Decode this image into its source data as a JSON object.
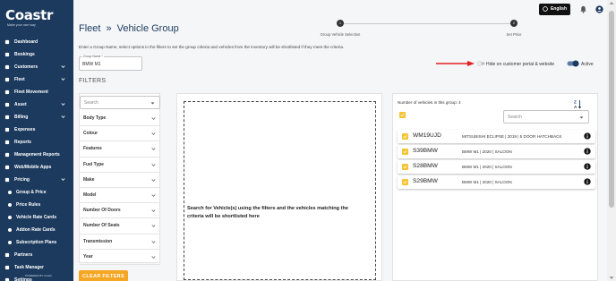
{
  "brand": {
    "logo_text": "Coastr",
    "tagline": "Make your own way"
  },
  "sidebar": {
    "items": [
      {
        "label": "Dashboard",
        "icon": "dashboard-icon",
        "expandable": false
      },
      {
        "label": "Bookings",
        "icon": "bookings-icon",
        "expandable": false
      },
      {
        "label": "Customers",
        "icon": "customers-icon",
        "expandable": true
      },
      {
        "label": "Fleet",
        "icon": "fleet-icon",
        "expandable": true
      },
      {
        "label": "Fleet Movement",
        "icon": "fleet-movement-icon",
        "expandable": false
      },
      {
        "label": "Asset",
        "icon": "asset-icon",
        "expandable": true
      },
      {
        "label": "Billing",
        "icon": "billing-icon",
        "expandable": true
      },
      {
        "label": "Expenses",
        "icon": "expenses-icon",
        "expandable": false
      },
      {
        "label": "Reports",
        "icon": "reports-icon",
        "expandable": false
      },
      {
        "label": "Management Reports",
        "icon": "management-reports-icon",
        "expandable": false
      },
      {
        "label": "Web/Mobile Apps",
        "icon": "web-mobile-apps-icon",
        "expandable": false
      },
      {
        "label": "Pricing",
        "icon": "pricing-icon",
        "expandable": true
      },
      {
        "label": "Group & Price",
        "sub": true
      },
      {
        "label": "Price Rules",
        "sub": true
      },
      {
        "label": "Vehicle Rate Cards",
        "sub": true
      },
      {
        "label": "Addon Rate Cards",
        "sub": true
      },
      {
        "label": "Subscription Plans",
        "sub": true
      },
      {
        "label": "Partners",
        "icon": "partners-icon",
        "expandable": false
      },
      {
        "label": "Task Manager",
        "icon": "task-manager-icon",
        "expandable": false
      },
      {
        "label": "Settings",
        "icon": "settings-icon",
        "expandable": false
      }
    ],
    "powered_by": "POWERED BY Coastr"
  },
  "header": {
    "breadcrumb_root": "Fleet",
    "separator": "»",
    "title": "Vehicle Group",
    "language_label": "English"
  },
  "stepper": {
    "steps": [
      {
        "number": "1",
        "label": "Group Vehicle Selection"
      },
      {
        "number": "2",
        "label": "Set Price"
      }
    ]
  },
  "intro_text": "Enter a Group Name, select options in the filters to set the group criteria and vehicles from the inventory will be shortlisted if they meet the criteria.",
  "group_name": {
    "label": "Group Name *",
    "value": "BMW M1"
  },
  "toggles": {
    "hide_label": "Hide on customer portal & website",
    "hide_on": false,
    "active_label": "Active",
    "active_on": true
  },
  "filters": {
    "heading": "FILTERS",
    "search_placeholder": "Search",
    "items": [
      "Body Type",
      "Colour",
      "Features",
      "Fuel Type",
      "Make",
      "Model",
      "Number Of Doors",
      "Number Of Seats",
      "Transmission",
      "Year"
    ],
    "clear_label": "CLEAR FILTERS"
  },
  "middle": {
    "message": "Search for Vehicle(s) using the filters and the vehicles matching the criteria will be shortlisted here"
  },
  "group_vehicles": {
    "count_label": "Number of vehicles in this group: 4",
    "sort_top": "Z",
    "sort_bottom": "A",
    "search_placeholder": "Search",
    "vehicles": [
      {
        "plate": "WM19UJD",
        "desc": "MITSUBISHI ECLIPSE | 2019 | 5 DOOR HATCHBACK"
      },
      {
        "plate": "S39BMW",
        "desc": "BMW M1 | 2020 | SALOON"
      },
      {
        "plate": "S28BMW",
        "desc": "BMW M1 | 2020 | SALOON"
      },
      {
        "plate": "S29BMW",
        "desc": "BMW M1 | 2020 | SALOON"
      }
    ]
  },
  "colors": {
    "sidebar": "#1c3a5e",
    "accent_orange": "#f5a623",
    "checkbox_yellow": "#f5c231",
    "toggle_active": "#1c3a5e",
    "annotation_arrow": "#e02020"
  }
}
